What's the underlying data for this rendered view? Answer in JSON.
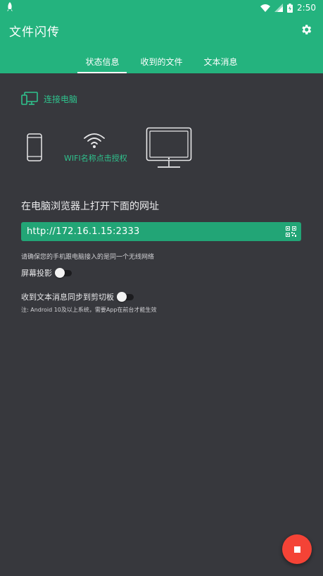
{
  "status_bar": {
    "time": "2:50",
    "battery_icon": "battery-charging-icon",
    "wifi_icon": "wifi-icon",
    "signal_icon": "signal-icon",
    "app_icon": "rocket-icon"
  },
  "app": {
    "title": "文件闪传",
    "settings_icon": "gear-icon"
  },
  "tabs": [
    {
      "label": "状态信息",
      "active": true
    },
    {
      "label": "收到的文件",
      "active": false
    },
    {
      "label": "文本消息",
      "active": false
    }
  ],
  "connect": {
    "label": "连接电脑",
    "icon": "devices-icon"
  },
  "illustration": {
    "wifi_hint": "WIFI名称点击授权"
  },
  "main": {
    "heading": "在电脑浏览器上打开下面的网址",
    "url": "http://172.16.1.15:2333",
    "qr_icon": "qr-code-icon",
    "same_network_note": "请确保您的手机跟电脑接入的是同一个无线网络",
    "screen_projection_label": "屏幕投影",
    "screen_projection_on": false,
    "clipboard_sync_label": "收到文本消息同步到剪切板",
    "clipboard_sync_on": false,
    "android_note": "注: Android 10及以上系统，需要App在前台才能生效"
  },
  "fab": {
    "icon": "stop-icon"
  },
  "colors": {
    "accent": "#24b37e",
    "accent_text": "#2fc28d",
    "background": "#37383d",
    "fab": "#f44336"
  }
}
